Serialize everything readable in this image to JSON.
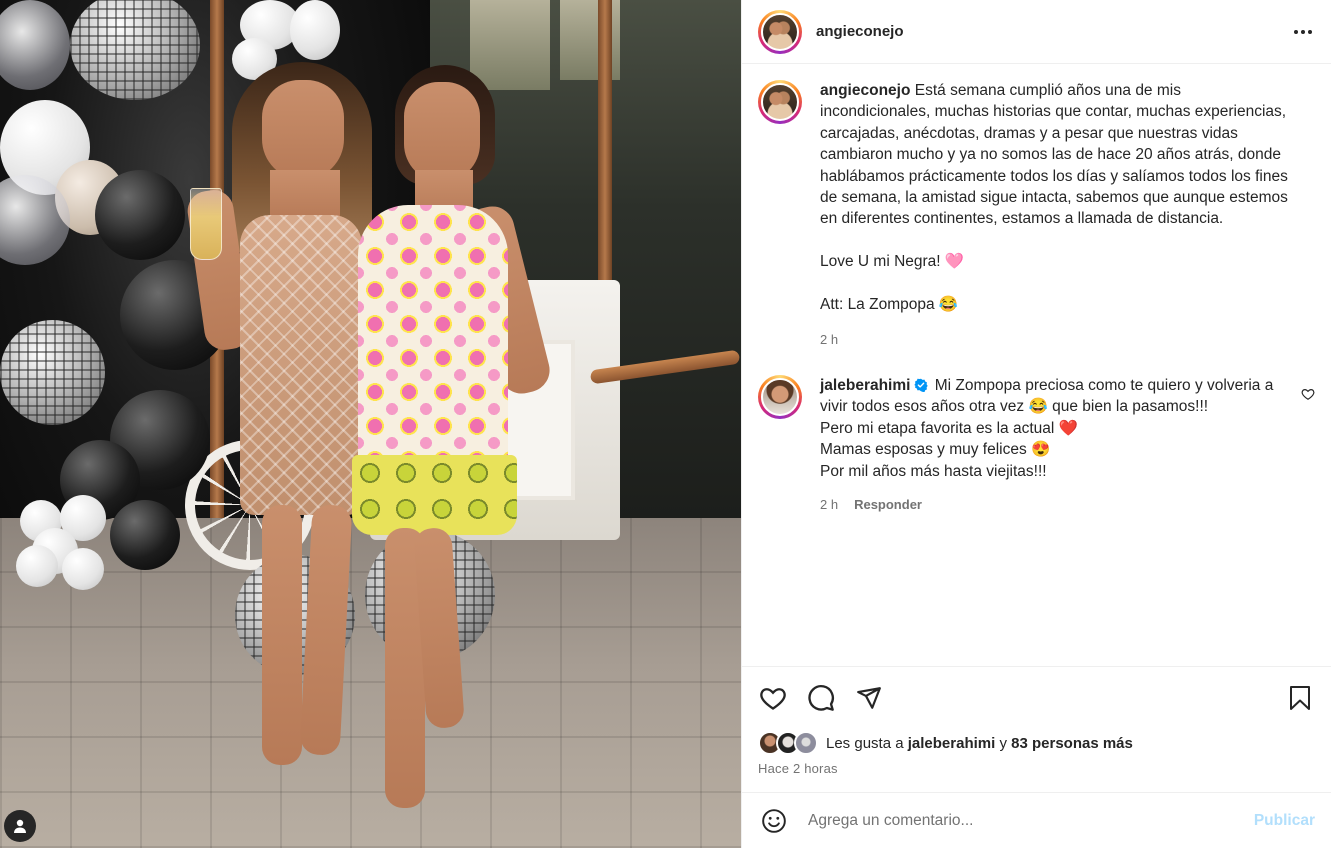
{
  "post": {
    "author": "angieconejo",
    "more_label": "•••"
  },
  "caption": {
    "username": "angieconejo",
    "text": " Está semana cumplió años una de mis incondicionales, muchas historias que contar, muchas experiencias, carcajadas, anécdotas, dramas y a pesar que nuestras vidas cambiaron mucho y ya no somos las de hace 20 años atrás, donde hablábamos prácticamente todos los días y salíamos todos los fines de semana, la amistad sigue intacta, sabemos que aunque estemos en diferentes continentes, estamos a llamada de distancia.\n\nLove U mi Negra! 🩷\n\nAtt: La Zompopa 😂",
    "time": "2 h"
  },
  "comments": [
    {
      "username": "jaleberahimi",
      "verified": true,
      "text": " Mi Zompopa preciosa como te quiero y volveria a vivir todos esos años otra vez 😂 que bien la pasamos!!!\nPero mi etapa favorita es la actual ❤️\nMamas esposas y muy felices 😍\nPor mil años más hasta viejitas!!!",
      "time": "2 h",
      "reply_label": "Responder"
    }
  ],
  "likes": {
    "prefix": "Les gusta a ",
    "liker": "jaleberahimi",
    "middle": " y ",
    "others": "83 personas más"
  },
  "time_ago": "Hace 2 horas",
  "composer": {
    "placeholder": "Agrega un comentario...",
    "publish_label": "Publicar"
  },
  "colors": {
    "publish_disabled": "#b2dffc",
    "verified_blue": "#0095f6",
    "secondary_text": "#737373"
  },
  "icons": [
    "more-icon",
    "heart-icon",
    "comment-icon",
    "share-icon",
    "bookmark-icon",
    "emoji-icon",
    "verified-icon",
    "user-tag-icon"
  ]
}
